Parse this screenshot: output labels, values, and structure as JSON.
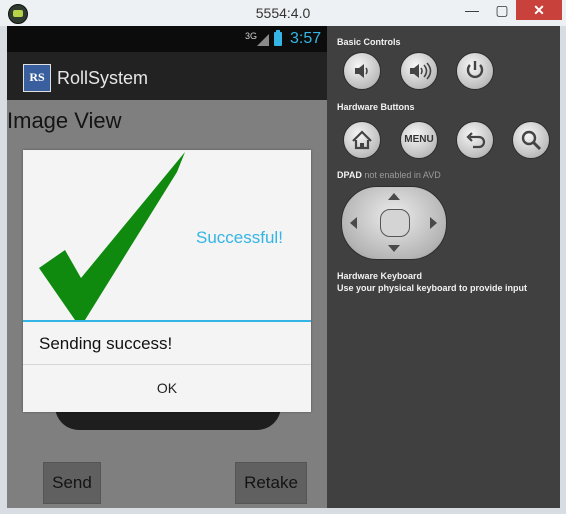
{
  "window": {
    "title": "5554:4.0",
    "minimize_glyph": "—",
    "maximize_glyph": "▢",
    "close_glyph": "✕"
  },
  "status_bar": {
    "network": "3G",
    "time": "3:57"
  },
  "action_bar": {
    "logo_text": "RS",
    "app_name": "RollSystem"
  },
  "page": {
    "image_view_label": "Image View"
  },
  "dialog": {
    "title": "Successful!",
    "message": "Sending success!",
    "ok_label": "OK",
    "check_color": "#0f8a0f"
  },
  "bottom_buttons": {
    "send": "Send",
    "retake": "Retake"
  },
  "side_panel": {
    "basic_controls_label": "Basic Controls",
    "basic_controls": [
      "volume-down-icon",
      "volume-up-icon",
      "power-icon"
    ],
    "hardware_buttons_label": "Hardware Buttons",
    "hardware_buttons": [
      "home-icon",
      "menu-button",
      "back-icon",
      "search-icon"
    ],
    "menu_label": "MENU",
    "dpad_label": "DPAD",
    "dpad_note": "not enabled in AVD",
    "keyboard_label": "Hardware Keyboard",
    "keyboard_note": "Use your physical keyboard to provide input"
  },
  "colors": {
    "accent": "#33b5e5",
    "panel_bg": "#404040",
    "close_button": "#c8413b"
  }
}
